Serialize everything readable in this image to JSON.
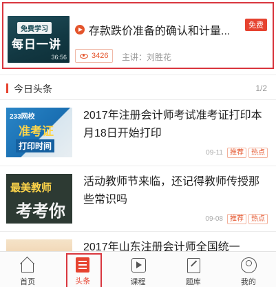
{
  "featured": {
    "thumb_tag": "免费学习",
    "thumb_title": "每日一讲",
    "thumb_duration": "36:56",
    "title": "存款跌价准备的确认和计量...",
    "free_badge": "免费",
    "views": "3426",
    "teacher": "主讲：刘胜花",
    "icons": {
      "play": "play-icon",
      "views": "eye-icon"
    }
  },
  "section": {
    "label": "今日头条",
    "pager": "1/2"
  },
  "news": [
    {
      "title": "2017年注册会计师考试准考证打印本月18日开始打印",
      "date": "09-11",
      "tags": [
        "推荐",
        "热点"
      ],
      "thumb_text": [
        "233网校",
        "准考证",
        "打印时间"
      ]
    },
    {
      "title": "活动教师节来临，还记得教师传授那些常识吗",
      "date": "09-08",
      "tags": [
        "推荐",
        "热点"
      ],
      "thumb_text": [
        "最美教师",
        "考考你"
      ]
    },
    {
      "title": "2017年山东注册会计师全国统一"
    }
  ],
  "tabbar": {
    "items": [
      {
        "label": "首页",
        "icon": "home-icon"
      },
      {
        "label": "头条",
        "icon": "news-icon"
      },
      {
        "label": "课程",
        "icon": "course-icon"
      },
      {
        "label": "题库",
        "icon": "question-bank-icon"
      },
      {
        "label": "我的",
        "icon": "profile-icon"
      }
    ],
    "active": "头条"
  },
  "colors": {
    "accent": "#e64330",
    "highlight_border": "#d9363e"
  }
}
